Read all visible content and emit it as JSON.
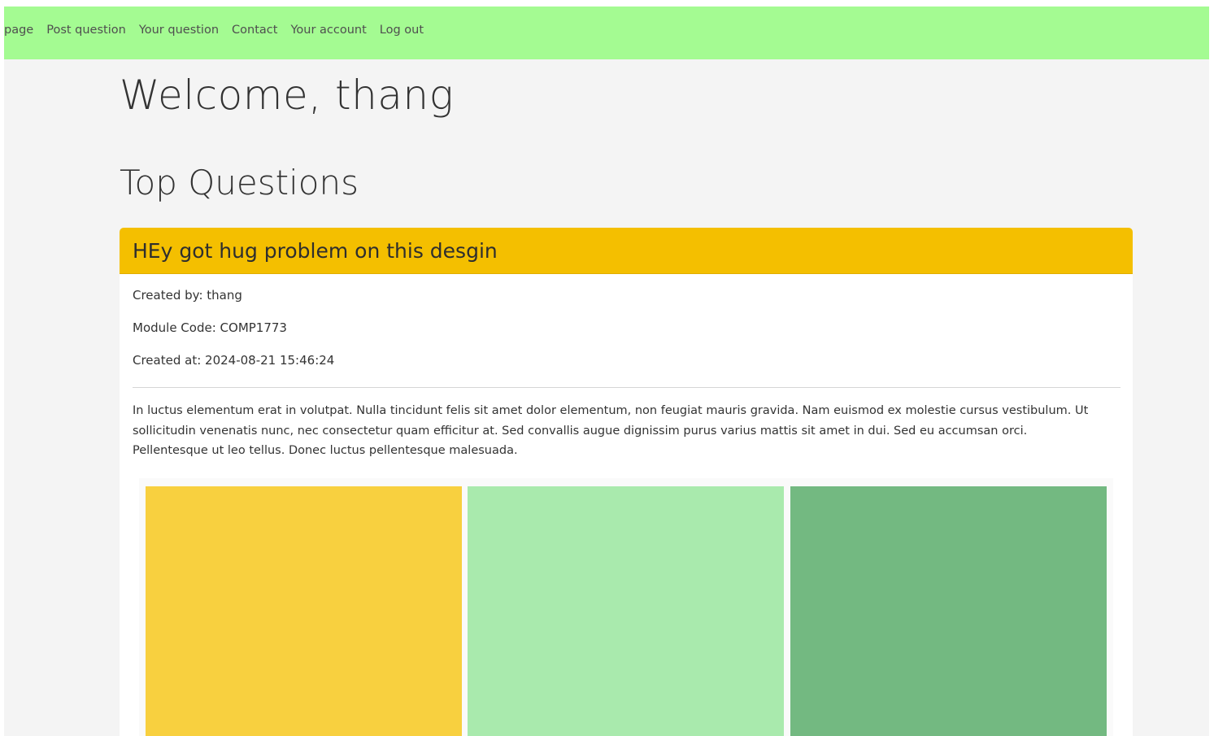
{
  "nav": {
    "items": [
      {
        "label": "page"
      },
      {
        "label": "Post question"
      },
      {
        "label": "Your question"
      },
      {
        "label": "Contact"
      },
      {
        "label": "Your account"
      },
      {
        "label": "Log out"
      }
    ]
  },
  "welcome": "Welcome, thang",
  "section_title": "Top Questions",
  "question": {
    "title": "HEy got hug problem on this desgin",
    "created_by": "Created by: thang",
    "module_code": "Module Code: COMP1773",
    "created_at": "Created at: 2024-08-21 15:46:24",
    "body": "In luctus elementum erat in volutpat. Nulla tincidunt felis sit amet dolor elementum, non feugiat mauris gravida. Nam euismod ex molestie cursus vestibulum. Ut sollicitudin venenatis nunc, nec consectetur quam efficitur at. Sed convallis augue dignissim purus varius mattis sit amet in dui. Sed eu accumsan orci. Pellentesque ut leo tellus. Donec luctus pellentesque malesuada.",
    "images": [
      {
        "color": "#f8d03f"
      },
      {
        "color": "#a9eaad"
      },
      {
        "color": "#73b981"
      }
    ]
  },
  "colors": {
    "navbar": "#a4fb92",
    "card_header": "#f4bf00",
    "page_bg": "#f4f4f4"
  }
}
